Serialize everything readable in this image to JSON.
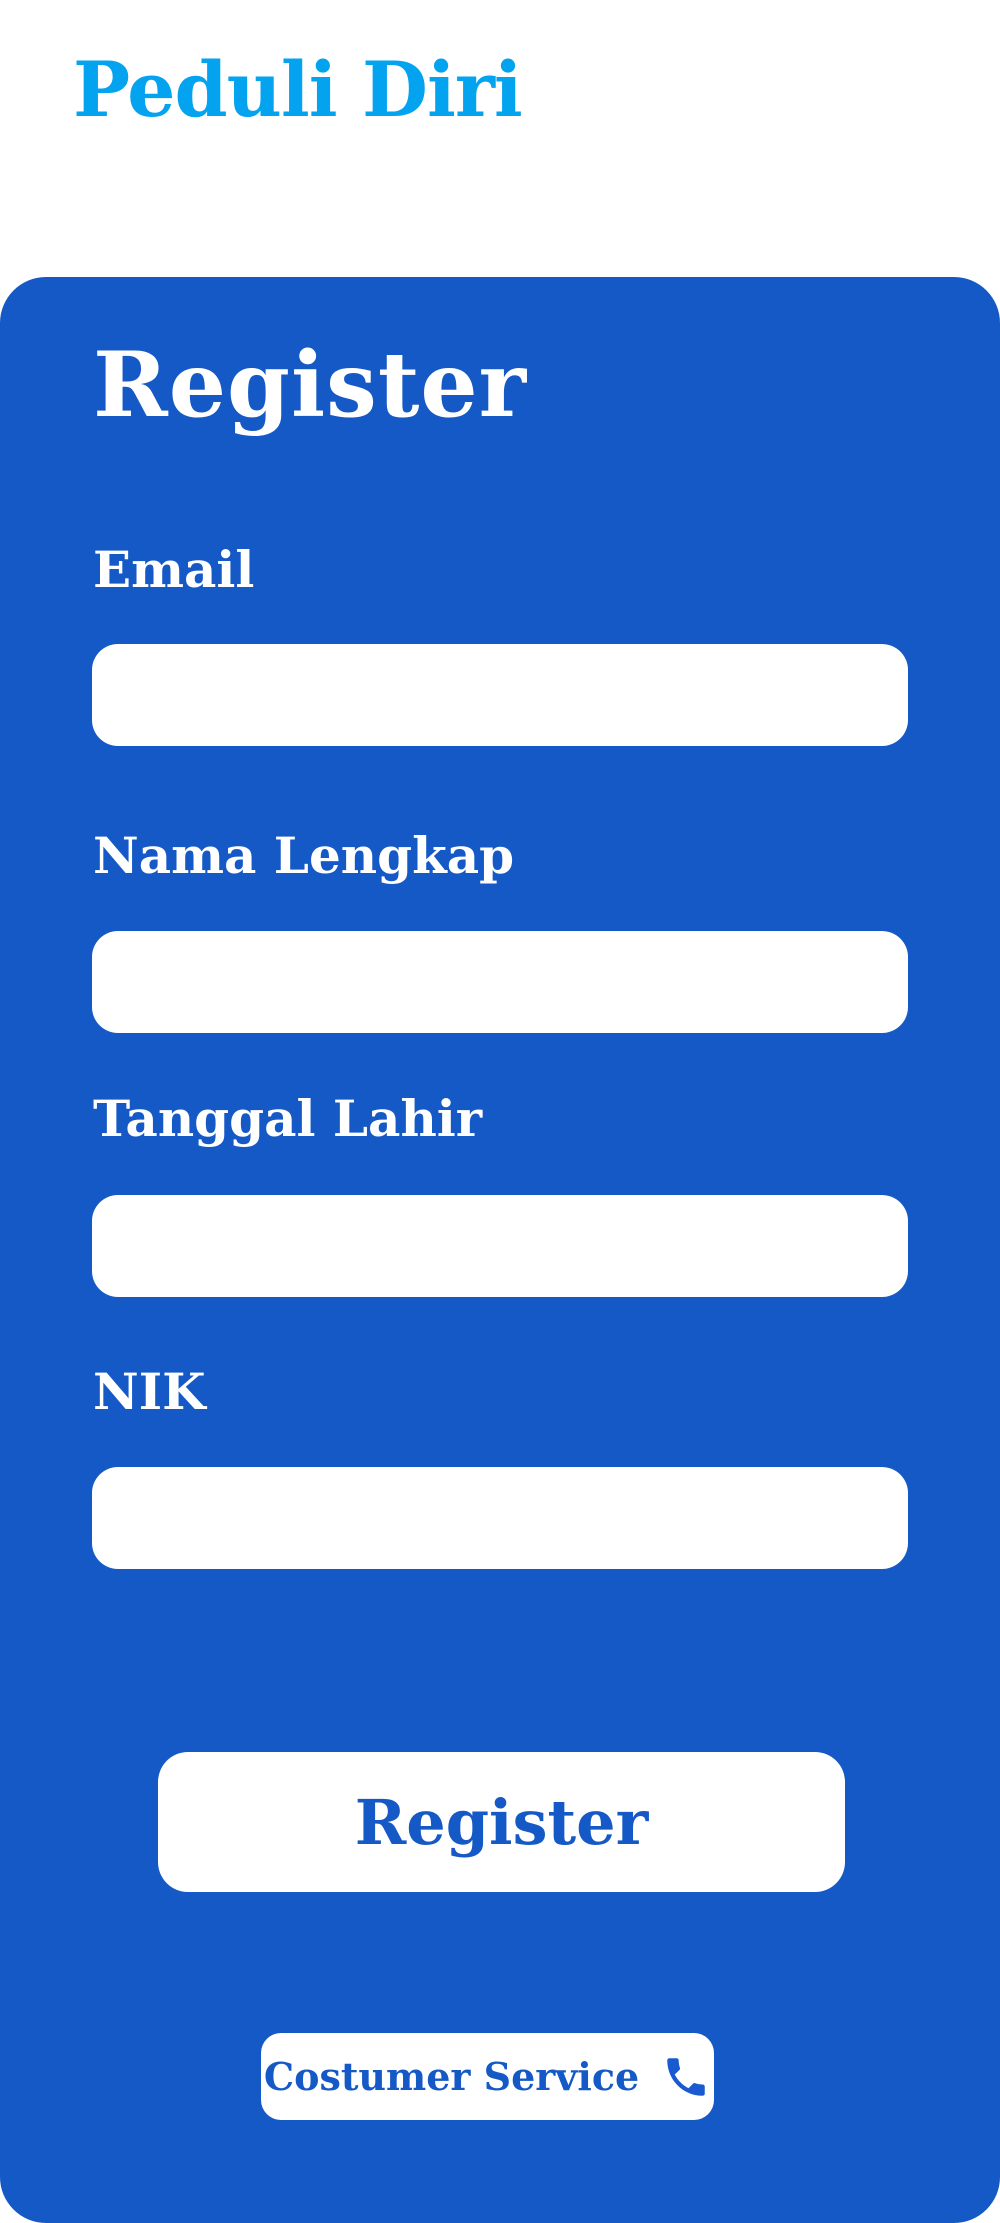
{
  "app": {
    "title": "Peduli Diri"
  },
  "form": {
    "title": "Register",
    "fields": [
      {
        "label": "Email",
        "value": "",
        "placeholder": ""
      },
      {
        "label": "Nama Lengkap",
        "value": "",
        "placeholder": ""
      },
      {
        "label": "Tanggal Lahir",
        "value": "",
        "placeholder": ""
      },
      {
        "label": "NIK",
        "value": "",
        "placeholder": ""
      }
    ],
    "submit_label": "Register"
  },
  "support": {
    "label": "Costumer Service",
    "icon": "phone-icon"
  },
  "colors": {
    "brand": "#03a3ef",
    "card": "#1559c6",
    "surface": "#ffffff"
  }
}
